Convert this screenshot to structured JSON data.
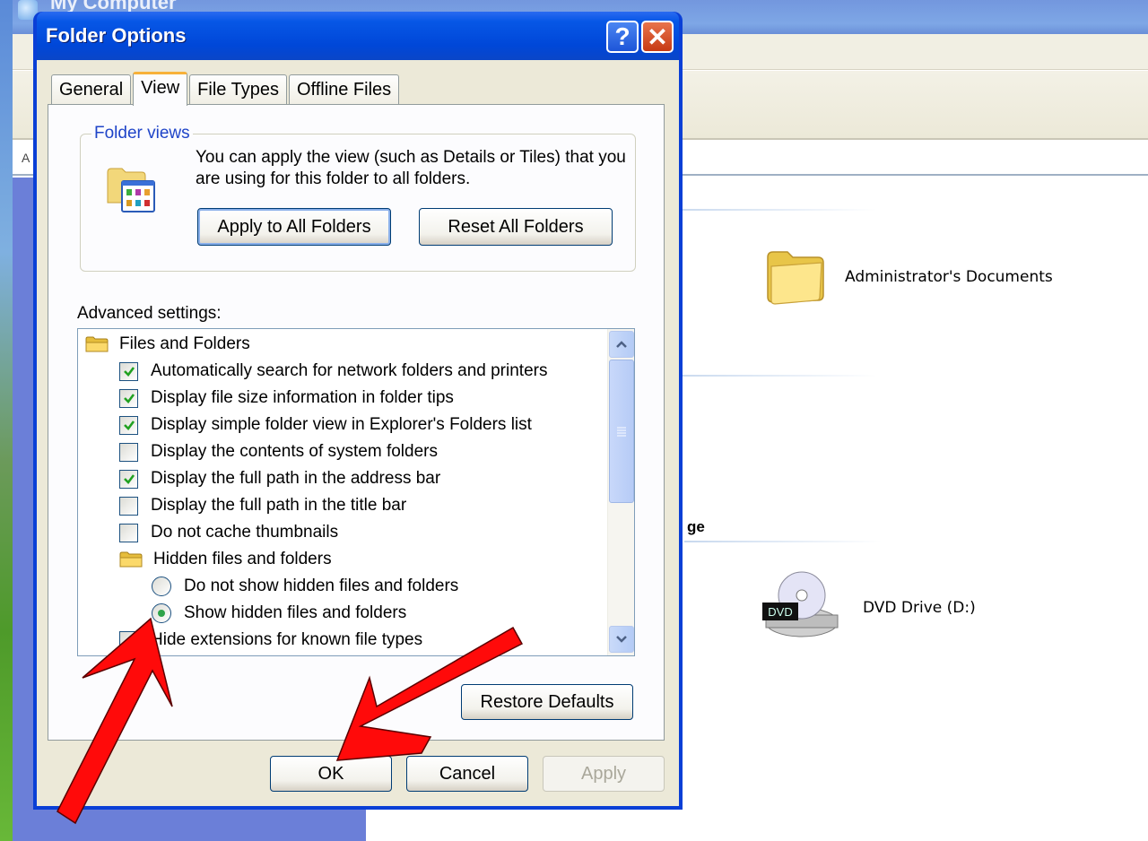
{
  "background_window": {
    "title": "My Computer",
    "address_label": "A",
    "groups": [
      {
        "header": "",
        "items": [
          {
            "label": "Administrator's Documents",
            "icon": "folder-icon"
          }
        ]
      },
      {
        "header": "ge",
        "items": [
          {
            "label": "DVD Drive (D:)",
            "icon": "dvd-drive-icon"
          }
        ]
      }
    ]
  },
  "dialog": {
    "title": "Folder Options",
    "help_button": "?",
    "close_button": "✕",
    "tabs": [
      {
        "label": "General",
        "active": false
      },
      {
        "label": "View",
        "active": true
      },
      {
        "label": "File Types",
        "active": false
      },
      {
        "label": "Offline Files",
        "active": false
      }
    ],
    "folder_views": {
      "legend": "Folder views",
      "description": "You can apply the view (such as Details or Tiles) that you are using for this folder to all folders.",
      "apply_button": "Apply to All Folders",
      "reset_button": "Reset All Folders"
    },
    "advanced": {
      "label": "Advanced settings:",
      "items": [
        {
          "type": "folder",
          "label": "Files and Folders",
          "indent": 0
        },
        {
          "type": "checkbox",
          "label": "Automatically search for network folders and printers",
          "checked": true,
          "indent": 1
        },
        {
          "type": "checkbox",
          "label": "Display file size information in folder tips",
          "checked": true,
          "indent": 1
        },
        {
          "type": "checkbox",
          "label": "Display simple folder view in Explorer's Folders list",
          "checked": true,
          "indent": 1
        },
        {
          "type": "checkbox",
          "label": "Display the contents of system folders",
          "checked": false,
          "indent": 1
        },
        {
          "type": "checkbox",
          "label": "Display the full path in the address bar",
          "checked": true,
          "indent": 1
        },
        {
          "type": "checkbox",
          "label": "Display the full path in the title bar",
          "checked": false,
          "indent": 1
        },
        {
          "type": "checkbox",
          "label": "Do not cache thumbnails",
          "checked": false,
          "indent": 1
        },
        {
          "type": "folder",
          "label": "Hidden files and folders",
          "indent": 1
        },
        {
          "type": "radio",
          "label": "Do not show hidden files and folders",
          "checked": false,
          "indent": 2
        },
        {
          "type": "radio",
          "label": "Show hidden files and folders",
          "checked": true,
          "indent": 2
        },
        {
          "type": "checkbox",
          "label": "Hide extensions for known file types",
          "checked": false,
          "indent": 1
        }
      ],
      "scroll_position": 0.0
    },
    "restore_defaults_button": "Restore Defaults",
    "ok_button": "OK",
    "cancel_button": "Cancel",
    "apply_button": "Apply",
    "colors": {
      "titlebar": "#0047d8",
      "body": "#ece9d8",
      "legend_text": "#1f44c8",
      "check_mark": "#21a121",
      "annotation_arrow": "#ff0000"
    }
  }
}
